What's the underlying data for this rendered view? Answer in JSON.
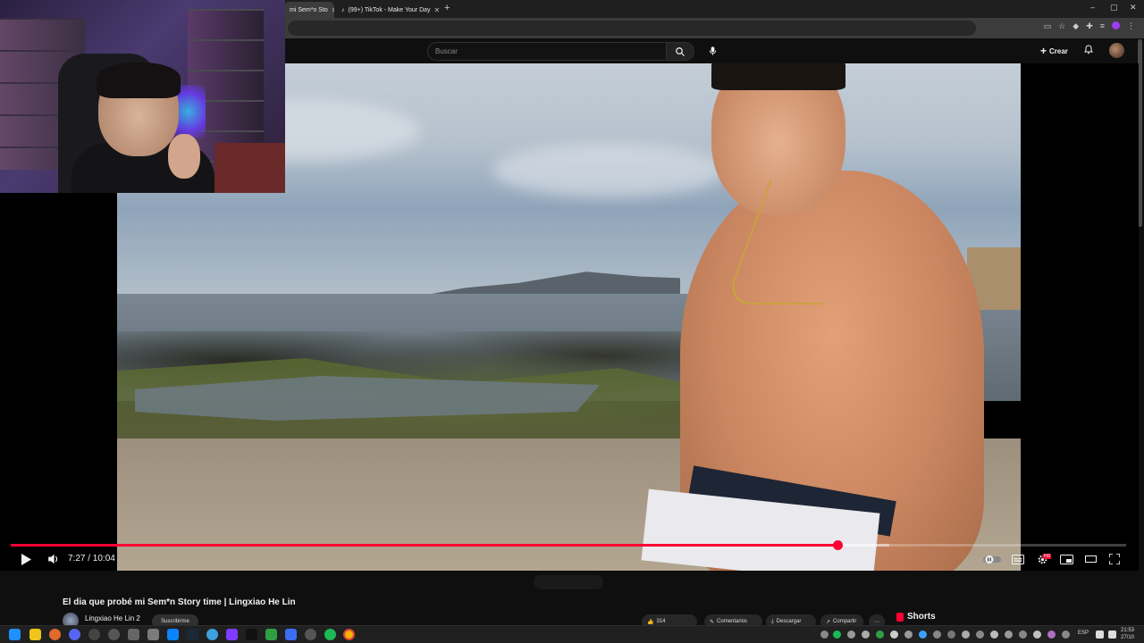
{
  "browser": {
    "tabs": [
      {
        "label": "mi Sem*n Sto",
        "active": true
      },
      {
        "label": "(99+) TikTok - Make Your Day",
        "active": false
      }
    ],
    "new_tab": "+",
    "window_controls": {
      "minimize": "–",
      "maximize": "▢",
      "close": "✕"
    }
  },
  "youtube": {
    "search_placeholder": "Buscar",
    "create_label": "Crear",
    "icons": [
      "search-icon",
      "mic-icon",
      "plus-icon",
      "bell-icon",
      "avatar"
    ]
  },
  "player": {
    "current_time": "7:27",
    "duration": "10:04",
    "time_display": "7:27 / 10:04",
    "progress_fraction": 0.741,
    "buffered_fraction": 0.788,
    "hd_badge": "HD",
    "accent_color": "#ff0033"
  },
  "video_info": {
    "title": "El dia que probé mi Sem*n Story time | Lingxiao He Lin",
    "channel_name": "Lingxiao He Lin 2",
    "subscribe_label": "Suscribirme",
    "actions": [
      {
        "name": "like",
        "label": "314"
      },
      {
        "name": "comments",
        "label": "Comentarios"
      },
      {
        "name": "download",
        "label": "Descargar"
      },
      {
        "name": "share",
        "label": "Compartir"
      }
    ],
    "shorts_label": "Shorts"
  },
  "taskbar": {
    "language": "ESP",
    "time": "21:53",
    "date": "27/10"
  }
}
